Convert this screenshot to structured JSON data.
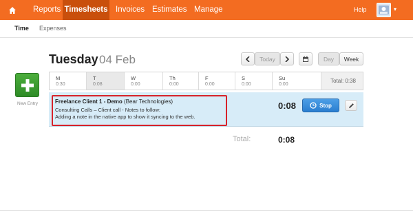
{
  "nav": {
    "items": [
      {
        "label": "Reports"
      },
      {
        "label": "Timesheets"
      },
      {
        "label": "Invoices"
      },
      {
        "label": "Estimates"
      },
      {
        "label": "Manage"
      }
    ],
    "help": "Help",
    "icons": {
      "home": "home-icon",
      "avatar": "avatar-icon",
      "menu": "chevron-down-icon"
    },
    "accent": "#f36c21"
  },
  "subnav": {
    "items": [
      {
        "label": "Time"
      },
      {
        "label": "Expenses"
      }
    ]
  },
  "heading": {
    "day": "Tuesday",
    "date": "04 Feb"
  },
  "controls": {
    "prev": "‹",
    "today": "Today",
    "next": "›",
    "calendar_icon": "calendar-icon",
    "day": "Day",
    "week": "Week"
  },
  "new_entry": {
    "label": "New Entry",
    "icon": "plus-icon"
  },
  "week": {
    "days": [
      {
        "name": "M",
        "hours": "0:30"
      },
      {
        "name": "T",
        "hours": "0:08"
      },
      {
        "name": "W",
        "hours": "0:00"
      },
      {
        "name": "Th",
        "hours": "0:00"
      },
      {
        "name": "F",
        "hours": "0:00"
      },
      {
        "name": "S",
        "hours": "0:00"
      },
      {
        "name": "Su",
        "hours": "0:00"
      }
    ],
    "total": "Total: 0:38"
  },
  "entry": {
    "project": "Freelance Client 1 - Demo",
    "client": "(Bear Technologies)",
    "task": "Consulting Calls  –  Client call - Notes to follow:",
    "notes": "Adding a note in the native app to show it syncing to the web.",
    "time": "0:08",
    "stop": "Stop",
    "stop_icon": "stopwatch-icon",
    "edit_icon": "pencil-icon"
  },
  "totals": {
    "label": "Total:",
    "value": "0:08"
  }
}
